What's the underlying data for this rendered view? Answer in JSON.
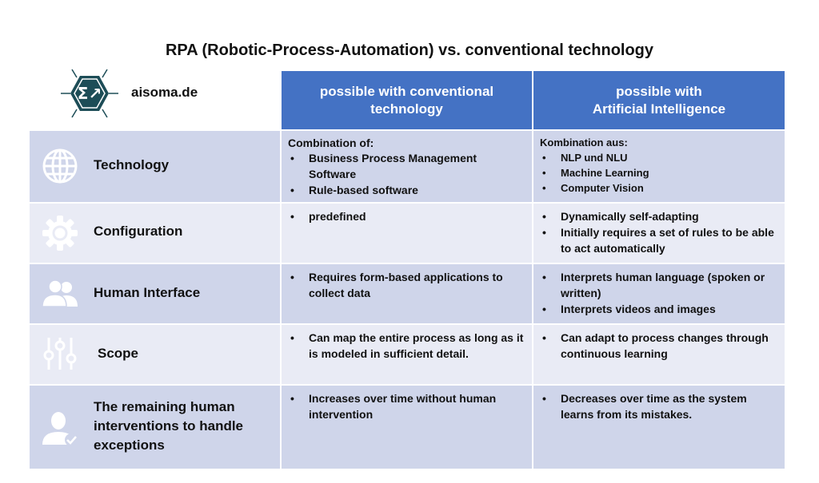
{
  "title": "RPA (Robotic-Process-Automation) vs. conventional technology",
  "brand": {
    "name": "aisoma.de",
    "logo_icon": "hexagon-sigma-logo"
  },
  "colors": {
    "header": "#4472c4",
    "row_dark": "#cfd5ea",
    "row_light": "#e9ebf5"
  },
  "columns": [
    {
      "label": "possible with conventional\ntechnology"
    },
    {
      "label": "possible with\nArtificial Intelligence"
    }
  ],
  "rows": [
    {
      "label": "Technology",
      "icon": "globe-icon",
      "conventional": {
        "intro": "Combination of:",
        "items": [
          "Business Process Management Software",
          "Rule-based software"
        ]
      },
      "ai": {
        "intro": "Kombination aus:",
        "items": [
          "NLP und NLU",
          "Machine Learning",
          "Computer Vision"
        ]
      }
    },
    {
      "label": "Configuration",
      "icon": "gear-icon",
      "conventional": {
        "items": [
          "predefined"
        ]
      },
      "ai": {
        "items": [
          "Dynamically self-adapting",
          "Initially requires a set of rules to be able to act automatically"
        ]
      }
    },
    {
      "label": "Human Interface",
      "icon": "users-icon",
      "conventional": {
        "items": [
          "Requires form-based applications to collect data"
        ]
      },
      "ai": {
        "items": [
          "Interprets human language (spoken or written)",
          "Interprets videos and images"
        ]
      }
    },
    {
      "label": "Scope",
      "icon": "sliders-icon",
      "conventional": {
        "items": [
          "Can map the entire process as long as it is modeled in sufficient detail."
        ]
      },
      "ai": {
        "items": [
          "Can adapt to process changes through continuous learning"
        ]
      }
    },
    {
      "label": "The remaining human interventions to handle exceptions",
      "icon": "user-check-icon",
      "conventional": {
        "items": [
          "Increases over time without human intervention"
        ]
      },
      "ai": {
        "items": [
          "Decreases over time as the system learns from its mistakes."
        ]
      }
    }
  ]
}
